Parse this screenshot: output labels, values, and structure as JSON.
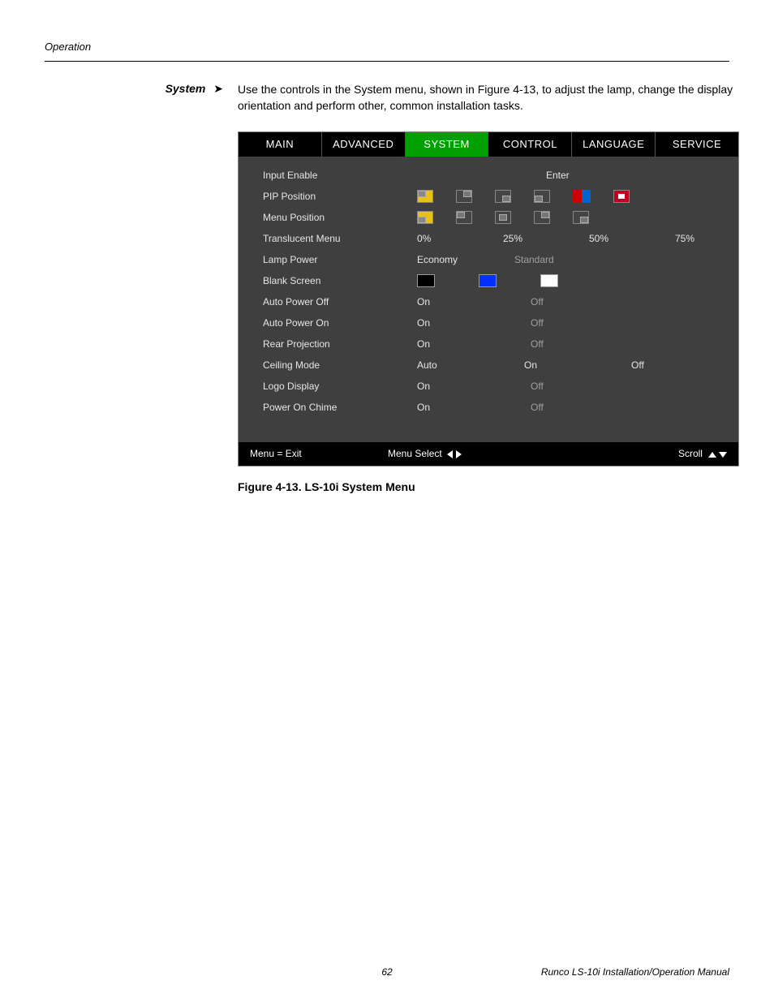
{
  "header": {
    "section": "Operation"
  },
  "sidebar": {
    "label": "System"
  },
  "intro": "Use the controls in the System menu, shown in Figure 4-13, to adjust the lamp, change the display orientation and perform other, common installation tasks.",
  "menu": {
    "tabs": [
      "MAIN",
      "ADVANCED",
      "SYSTEM",
      "CONTROL",
      "LANGUAGE",
      "SERVICE"
    ],
    "active_tab": 2,
    "rows": {
      "input_enable": {
        "label": "Input Enable",
        "value": "Enter"
      },
      "pip_position": {
        "label": "PIP Position"
      },
      "menu_position": {
        "label": "Menu Position"
      },
      "translucent": {
        "label": "Translucent Menu",
        "options": [
          "0%",
          "25%",
          "50%",
          "75%"
        ]
      },
      "lamp_power": {
        "label": "Lamp Power",
        "options": [
          "Economy",
          "Standard"
        ],
        "selected": 1
      },
      "blank_screen": {
        "label": "Blank Screen",
        "colors": [
          "#000000",
          "#0030ff",
          "#ffffff"
        ]
      },
      "auto_power_off": {
        "label": "Auto Power Off",
        "options": [
          "On",
          "Off"
        ],
        "selected": 1
      },
      "auto_power_on": {
        "label": "Auto Power On",
        "options": [
          "On",
          "Off"
        ],
        "selected": 1
      },
      "rear_projection": {
        "label": "Rear Projection",
        "options": [
          "On",
          "Off"
        ],
        "selected": 1
      },
      "ceiling_mode": {
        "label": "Ceiling Mode",
        "options": [
          "Auto",
          "On",
          "Off"
        ]
      },
      "logo_display": {
        "label": "Logo Display",
        "options": [
          "On",
          "Off"
        ],
        "selected": 1
      },
      "power_on_chime": {
        "label": "Power On Chime",
        "options": [
          "On",
          "Off"
        ],
        "selected": 1
      }
    },
    "footer": {
      "exit": "Menu = Exit",
      "select": "Menu Select",
      "scroll": "Scroll"
    }
  },
  "caption": "Figure 4-13. LS-10i System Menu",
  "page_footer": {
    "page": "62",
    "title": "Runco LS-10i Installation/Operation Manual"
  }
}
